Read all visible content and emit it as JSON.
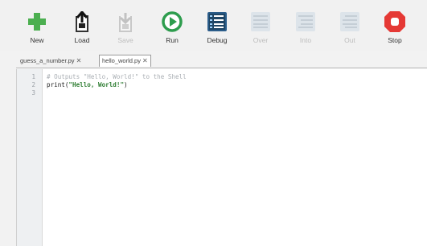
{
  "toolbar": {
    "new_label": "New",
    "load_label": "Load",
    "save_label": "Save",
    "run_label": "Run",
    "debug_label": "Debug",
    "over_label": "Over",
    "into_label": "Into",
    "out_label": "Out",
    "stop_label": "Stop"
  },
  "tabs": [
    {
      "label": "guess_a_number.py",
      "close": "✕"
    },
    {
      "label": "hello_world.py",
      "close": "✕"
    }
  ],
  "editor": {
    "line_numbers": [
      "1",
      "2",
      "3"
    ],
    "line1_comment": "# Outputs \"Hello, World!\" to the Shell",
    "line2_func": "print",
    "line2_open": "(",
    "line2_string": "\"Hello, World!\"",
    "line2_close": ")"
  },
  "colors": {
    "new_green": "#4caf50",
    "run_green": "#2e9d4e",
    "stop_red": "#e53935",
    "debug_blue": "#2b5d8a"
  }
}
